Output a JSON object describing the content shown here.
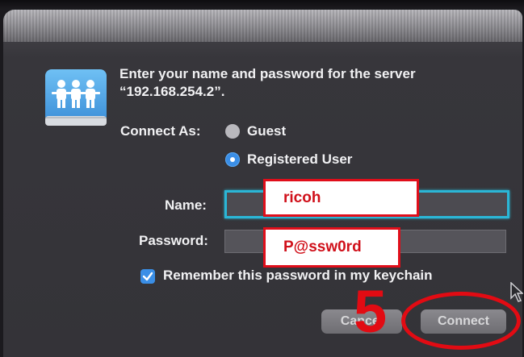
{
  "dialog": {
    "prompt_line1": "Enter your name and password for the server",
    "prompt_line2": "“192.168.254.2”.",
    "connect_as_label": "Connect As:",
    "options": [
      {
        "label": "Guest",
        "selected": false
      },
      {
        "label": "Registered User",
        "selected": true
      }
    ],
    "name_label": "Name:",
    "password_label": "Password:",
    "remember": {
      "label": "Remember this password in my keychain",
      "checked": true
    },
    "cancel_label": "Cancel",
    "connect_label": "Connect"
  },
  "annotations": {
    "name_value": "ricoh",
    "password_value": "P@ssw0rd",
    "step_number": "5",
    "highlight_color": "#e20b13"
  },
  "colors": {
    "accent": "#3a8ee6",
    "focus_ring": "#2bb6d6",
    "dialog_bg": "#36353a"
  }
}
